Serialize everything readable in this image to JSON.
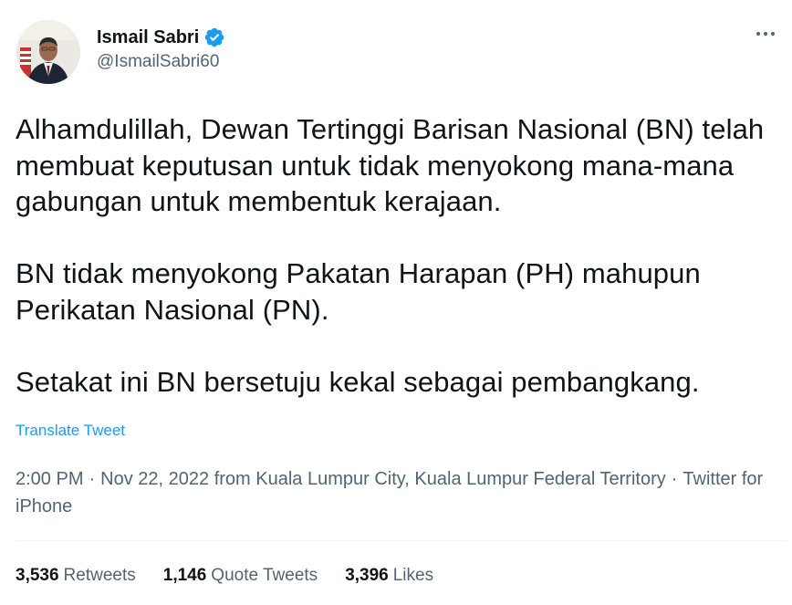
{
  "author": {
    "name": "Ismail Sabri",
    "handle": "@IsmailSabri60",
    "verified": true
  },
  "tweet": {
    "paragraphs": [
      "Alhamdulillah, Dewan Tertinggi Barisan Nasional (BN) telah membuat keputusan untuk tidak menyokong mana-mana gabungan untuk membentuk kerajaan.",
      "BN tidak menyokong Pakatan Harapan (PH) mahupun Perikatan Nasional (PN).",
      "Setakat ini BN bersetuju kekal sebagai pembangkang."
    ],
    "translate_label": "Translate Tweet"
  },
  "meta": {
    "time": "2:00 PM",
    "date": "Nov 22, 2022",
    "location": "from Kuala Lumpur City, Kuala Lumpur Federal Territory",
    "source": "Twitter for iPhone"
  },
  "stats": {
    "retweets": {
      "count": "3,536",
      "label": "Retweets"
    },
    "quotes": {
      "count": "1,146",
      "label": "Quote Tweets"
    },
    "likes": {
      "count": "3,396",
      "label": "Likes"
    }
  },
  "colors": {
    "link": "#1d9bf0",
    "text": "#0f1419",
    "secondary": "#536471",
    "verified_badge": "#1d9bf0"
  }
}
